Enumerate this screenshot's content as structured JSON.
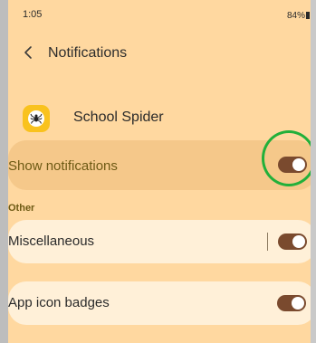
{
  "status_bar": {
    "time": "1:05",
    "battery": "84%"
  },
  "header": {
    "back_icon": "chevron-left-icon",
    "title": "Notifications"
  },
  "app": {
    "icon": "spider-icon",
    "name": "School Spider"
  },
  "show_notifications": {
    "label": "Show notifications",
    "enabled": true
  },
  "sections": {
    "other_label": "Other"
  },
  "settings": {
    "miscellaneous": {
      "label": "Miscellaneous",
      "enabled": true
    },
    "app_icon_badges": {
      "label": "App icon badges",
      "enabled": true
    }
  },
  "colors": {
    "background": "#ffd8a0",
    "toggle_on": "#7a4a2e",
    "highlight_circle": "#22b03a"
  }
}
